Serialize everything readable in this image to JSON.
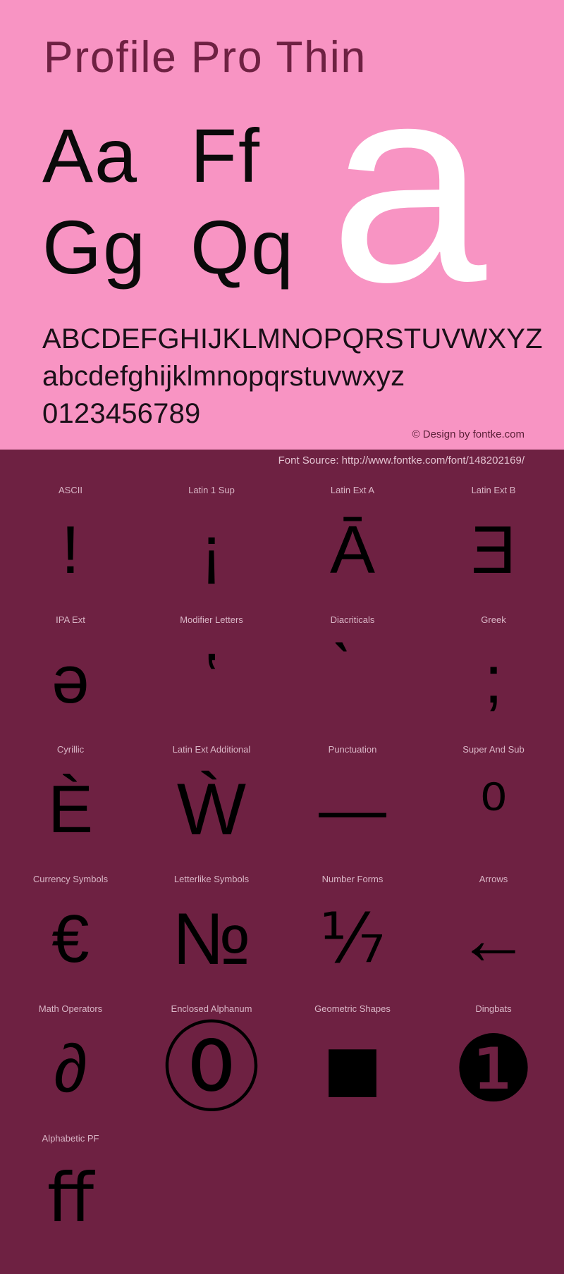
{
  "hero": {
    "title": "Profile Pro Thin",
    "big_glyph": "a",
    "pairs": [
      [
        "Aa",
        "Ff"
      ],
      [
        "Gg",
        "Qq"
      ]
    ],
    "uppercase": "ABCDEFGHIJKLMNOPQRSTUVWXYZ",
    "lowercase": "abcdefghijklmnopqrstuvwxyz",
    "digits": "0123456789",
    "copyright": "© Design by fontke.com",
    "bg_color": "#f894c3",
    "text_color": "#6e2142"
  },
  "source_bar": {
    "text": "Font Source: http://www.fontke.com/font/148202169/",
    "bg_color": "#6e2142",
    "text_color": "#e3c3d1"
  },
  "grid": {
    "bg_color": "#6e2142",
    "label_color": "#d9b6c6",
    "glyph_color": "#000000",
    "rows": [
      [
        {
          "label": "ASCII",
          "glyph": "!"
        },
        {
          "label": "Latin 1 Sup",
          "glyph": "¡"
        },
        {
          "label": "Latin Ext A",
          "glyph": "Ā"
        },
        {
          "label": "Latin Ext B",
          "glyph": "Ǝ"
        }
      ],
      [
        {
          "label": "IPA Ext",
          "glyph": "ə"
        },
        {
          "label": "Modifier Letters",
          "glyph": "ʽ"
        },
        {
          "label": "Diacriticals",
          "glyph": "̀"
        },
        {
          "label": "Greek",
          "glyph": ";"
        }
      ],
      [
        {
          "label": "Cyrillic",
          "glyph": "Ѐ"
        },
        {
          "label": "Latin Ext Additional",
          "glyph": "Ẁ"
        },
        {
          "label": "Punctuation",
          "glyph": "—"
        },
        {
          "label": "Super And Sub",
          "glyph": "⁰"
        }
      ],
      [
        {
          "label": "Currency Symbols",
          "glyph": "€"
        },
        {
          "label": "Letterlike Symbols",
          "glyph": "№"
        },
        {
          "label": "Number Forms",
          "glyph": "⅐"
        },
        {
          "label": "Arrows",
          "glyph": "←"
        }
      ],
      [
        {
          "label": "Math Operators",
          "glyph": "∂"
        },
        {
          "label": "Enclosed Alphanum",
          "glyph": "⓪"
        },
        {
          "label": "Geometric Shapes",
          "glyph": "■"
        },
        {
          "label": "Dingbats",
          "glyph": "❶"
        }
      ],
      [
        {
          "label": "Alphabetic PF",
          "glyph": "ﬀ"
        },
        {
          "label": "",
          "glyph": ""
        },
        {
          "label": "",
          "glyph": ""
        },
        {
          "label": "",
          "glyph": ""
        }
      ]
    ]
  }
}
